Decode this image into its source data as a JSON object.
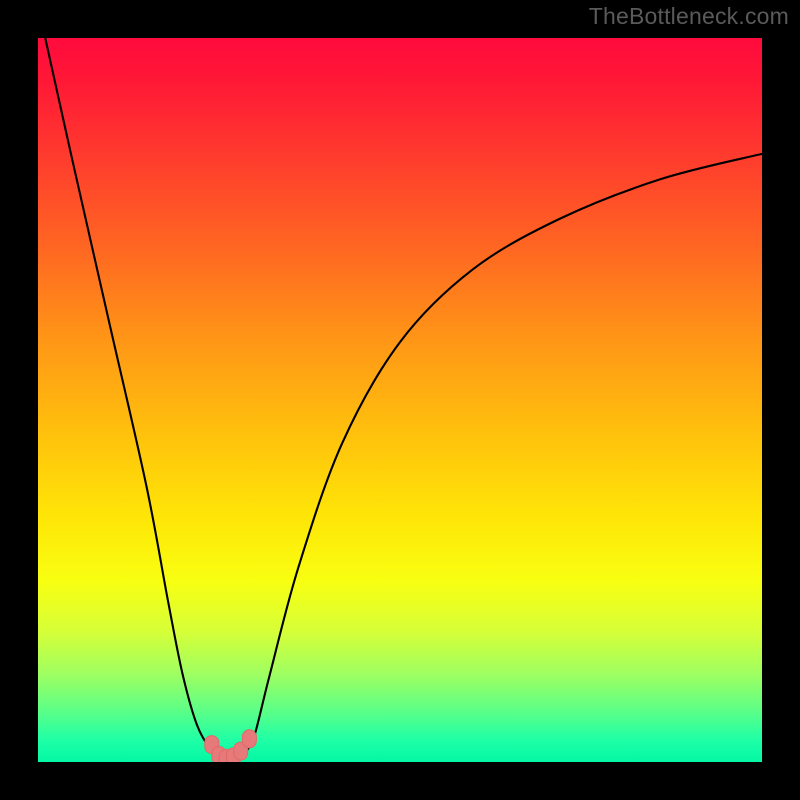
{
  "watermark": "TheBottleneck.com",
  "background_frame_color": "#000000",
  "gradient_stops": [
    {
      "pos": 0,
      "color": "#ff0b3d"
    },
    {
      "pos": 6,
      "color": "#ff1836"
    },
    {
      "pos": 16,
      "color": "#ff3a2e"
    },
    {
      "pos": 30,
      "color": "#ff6a21"
    },
    {
      "pos": 42,
      "color": "#ff9716"
    },
    {
      "pos": 54,
      "color": "#ffbf0d"
    },
    {
      "pos": 66,
      "color": "#ffe507"
    },
    {
      "pos": 75,
      "color": "#f8ff11"
    },
    {
      "pos": 82,
      "color": "#d6ff38"
    },
    {
      "pos": 88,
      "color": "#9dff62"
    },
    {
      "pos": 93,
      "color": "#5bff88"
    },
    {
      "pos": 97,
      "color": "#1effa6"
    },
    {
      "pos": 100,
      "color": "#04f7a5"
    }
  ],
  "marker_color": "#e67a7a",
  "chart_data": {
    "type": "line",
    "title": "",
    "xlabel": "",
    "ylabel": "",
    "xlim": [
      0,
      100
    ],
    "ylim": [
      0,
      100
    ],
    "grid": false,
    "series": [
      {
        "name": "curve",
        "x": [
          1,
          5,
          10,
          15,
          18,
          20,
          22,
          24,
          25,
          26,
          27,
          28,
          29,
          30,
          32,
          36,
          42,
          50,
          60,
          72,
          86,
          100
        ],
        "y": [
          100,
          82,
          60,
          38,
          22,
          12,
          5,
          1.5,
          0.8,
          0.5,
          0.5,
          0.8,
          1.8,
          4,
          12,
          27,
          44,
          58,
          68,
          75,
          80.5,
          84
        ]
      }
    ],
    "markers": [
      {
        "x": 24.0,
        "y": 2.4
      },
      {
        "x": 25.0,
        "y": 0.9
      },
      {
        "x": 26.0,
        "y": 0.5
      },
      {
        "x": 27.0,
        "y": 0.7
      },
      {
        "x": 28.0,
        "y": 1.5
      },
      {
        "x": 29.2,
        "y": 3.2
      }
    ],
    "annotations": []
  }
}
